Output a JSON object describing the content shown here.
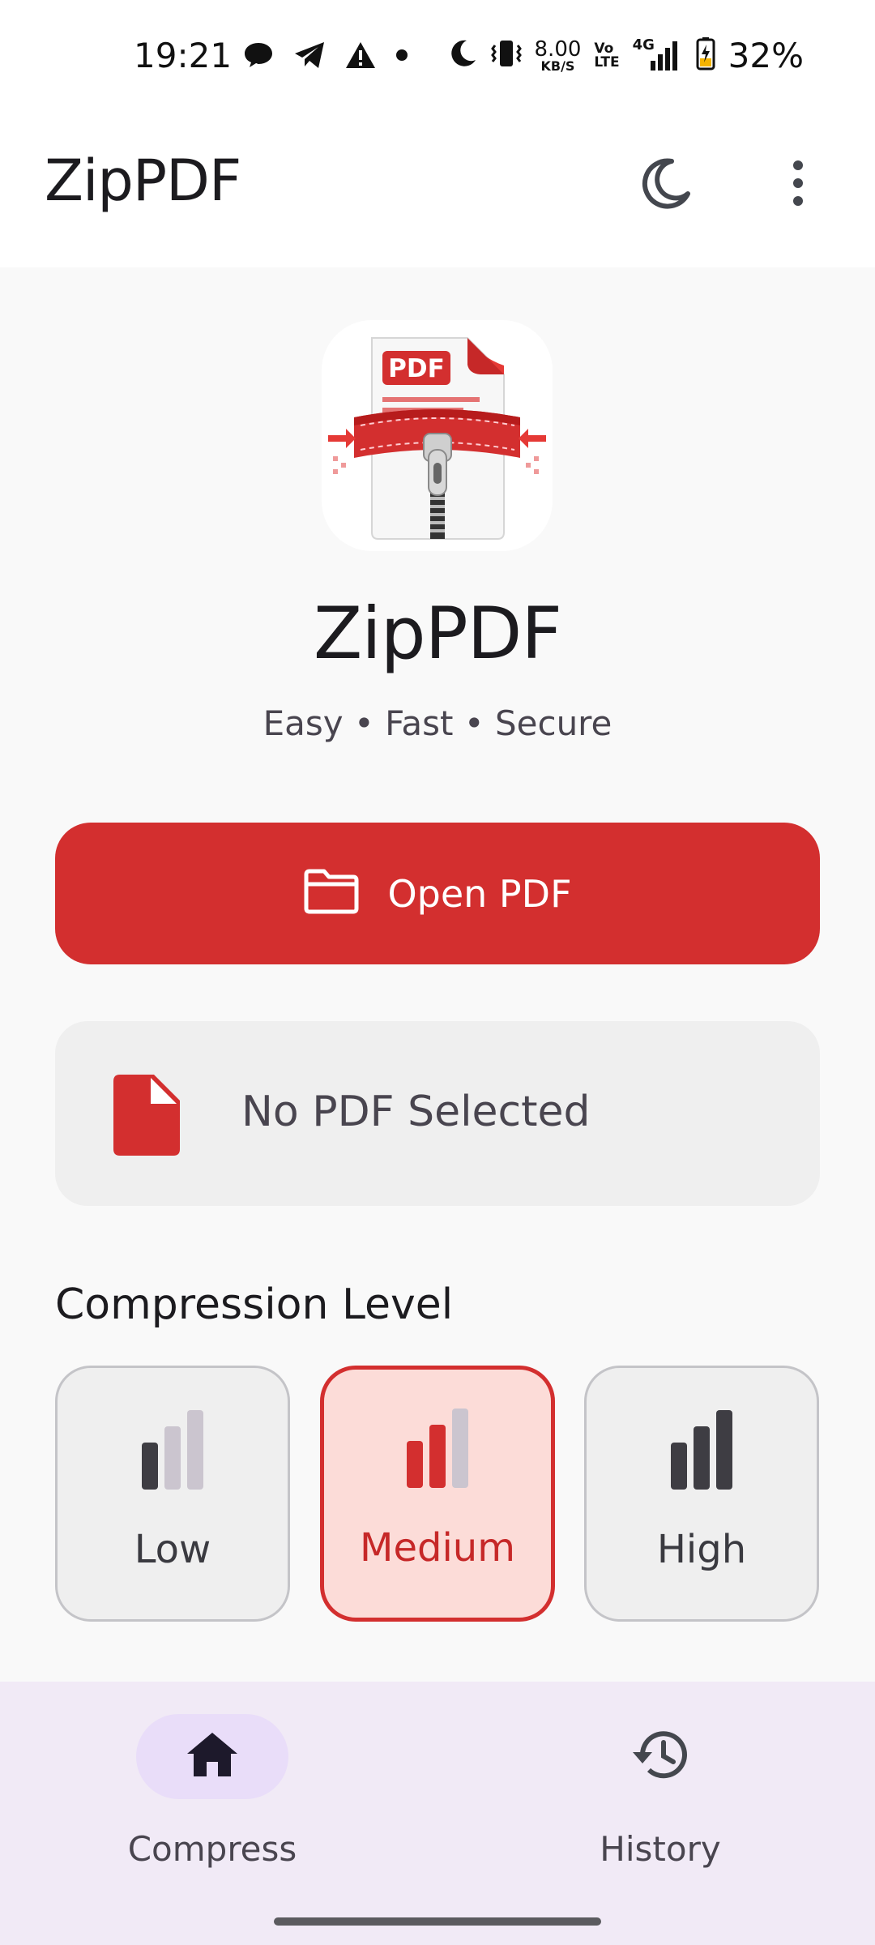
{
  "status_bar": {
    "time": "19:21",
    "net_speed_value": "8.00",
    "net_speed_unit": "KB/S",
    "volte_top": "Vo",
    "volte_bottom": "LTE",
    "network_type": "4G",
    "battery_percent": "32%",
    "icons": [
      "chat-bubble-icon",
      "telegram-icon",
      "warning-icon",
      "dot-icon",
      "moon-icon",
      "vibrate-icon",
      "signal-icon",
      "battery-charging-icon"
    ]
  },
  "app_bar": {
    "title": "ZipPDF",
    "theme_icon": "moon-icon",
    "menu_icon": "more-vert-icon"
  },
  "hero": {
    "logo_text": "PDF",
    "title": "ZipPDF",
    "tagline": "Easy • Fast • Secure"
  },
  "open_button": {
    "icon": "folder-icon",
    "label": "Open PDF"
  },
  "file_card": {
    "icon": "file-icon",
    "label": "No PDF Selected"
  },
  "compression": {
    "title": "Compression Level",
    "options": [
      {
        "label": "Low",
        "bars_active": 1,
        "selected": false
      },
      {
        "label": "Medium",
        "bars_active": 2,
        "selected": true
      },
      {
        "label": "High",
        "bars_active": 3,
        "selected": false
      }
    ]
  },
  "bottom_nav": {
    "items": [
      {
        "label": "Compress",
        "icon": "home-icon",
        "active": true
      },
      {
        "label": "History",
        "icon": "history-icon",
        "active": false
      }
    ]
  },
  "colors": {
    "accent": "#d32f2f",
    "selected_bg": "#fcdcd8",
    "nav_bg": "#f1eaf6",
    "nav_active_pill": "#e9ddf9"
  }
}
